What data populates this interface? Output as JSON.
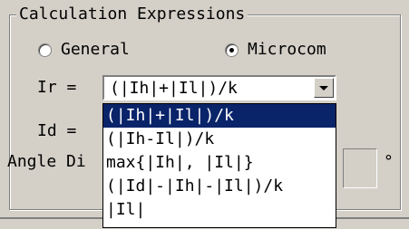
{
  "group": {
    "title": "Calculation Expressions"
  },
  "mode": {
    "options": [
      {
        "label": "General",
        "checked": false
      },
      {
        "label": "Microcom",
        "checked": true
      }
    ]
  },
  "fields": {
    "ir_label": "Ir =",
    "ir_value": "(|Ih|+|Il|)/k",
    "id_label": "Id =",
    "angle_label": "Angle Di",
    "unit_mark": "°"
  },
  "dropdown": {
    "items": [
      "(|Ih|+|Il|)/k",
      "(|Ih-Il|)/k",
      "max{|Ih|, |Il|}",
      "(|Id|-|Ih|-|Il|)/k",
      "|Il|"
    ],
    "selected_index": 0
  },
  "icons": {
    "combo_arrow": "chevron-down-icon"
  }
}
